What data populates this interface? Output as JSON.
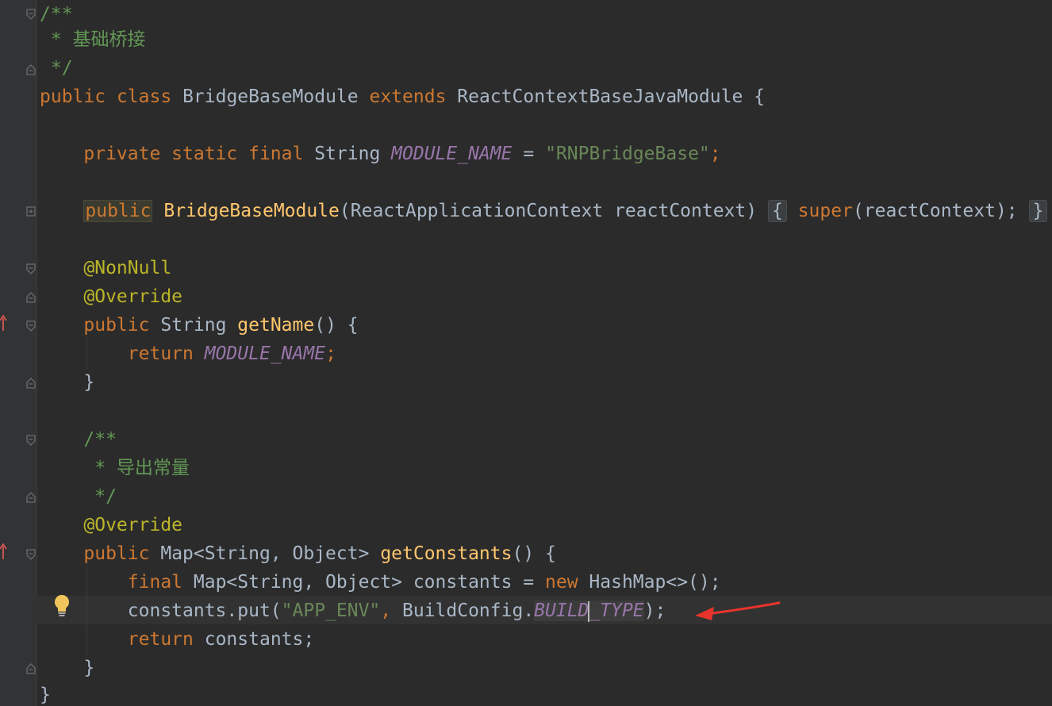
{
  "code": {
    "doc1_open": "/**",
    "doc1_text": " * 基础桥接",
    "doc1_close": " */",
    "class_public": "public",
    "class_class": "class",
    "class_name": "BridgeBaseModule",
    "class_extends": "extends",
    "class_parent": "ReactContextBaseJavaModule",
    "class_brace": "{",
    "field_modifiers": "private static final",
    "field_type": "String",
    "field_name": "MODULE_NAME",
    "field_eq": "=",
    "field_value": "\"RNPBridgeBase\"",
    "field_semi": ";",
    "ctor_public": "public",
    "ctor_name": "BridgeBaseModule",
    "ctor_params": "(ReactApplicationContext reactContext)",
    "ctor_open": "{",
    "ctor_super": "super",
    "ctor_args": "(reactContext);",
    "ctor_close": "}",
    "ann_nonnull": "@NonNull",
    "ann_override1": "@Override",
    "getname_public": "public",
    "getname_type": "String",
    "getname_name": "getName",
    "getname_rest": "() {",
    "return1_kw": "return",
    "return1_val": "MODULE_NAME",
    "return1_semi": ";",
    "close1": "}",
    "doc2_open": "/**",
    "doc2_text": " * 导出常量",
    "doc2_close": " */",
    "ann_override2": "@Override",
    "getconst_public": "public",
    "getconst_type": "Map<String, Object>",
    "getconst_name": "getConstants",
    "getconst_rest": "() {",
    "decl_final": "final",
    "decl_type": "Map<String, Object> constants =",
    "decl_new": "new",
    "decl_rest": "HashMap<>();",
    "put_call": "constants.put(",
    "put_key": "\"APP_ENV\"",
    "put_comma": ",",
    "put_cls": "BuildConfig.",
    "put_field_a": "BUILD",
    "put_field_b": "_TYPE",
    "put_end": ");",
    "return2_kw": "return",
    "return2_val": "constants;",
    "close2": "}",
    "close_class": "}"
  },
  "colors": {
    "background": "#2b2b2b",
    "keyword": "#cc7832",
    "comment": "#629755",
    "annotation": "#bbb529",
    "string": "#6a8759",
    "field": "#9876aa",
    "method": "#ffc66d",
    "text": "#a9b7c6",
    "arrow": "#e8342c"
  },
  "icons": {
    "intention": "lightbulb-icon",
    "marker": "red-arrow-annotation-icon",
    "fold": "fold-icon",
    "override": "override-marker-icon"
  }
}
